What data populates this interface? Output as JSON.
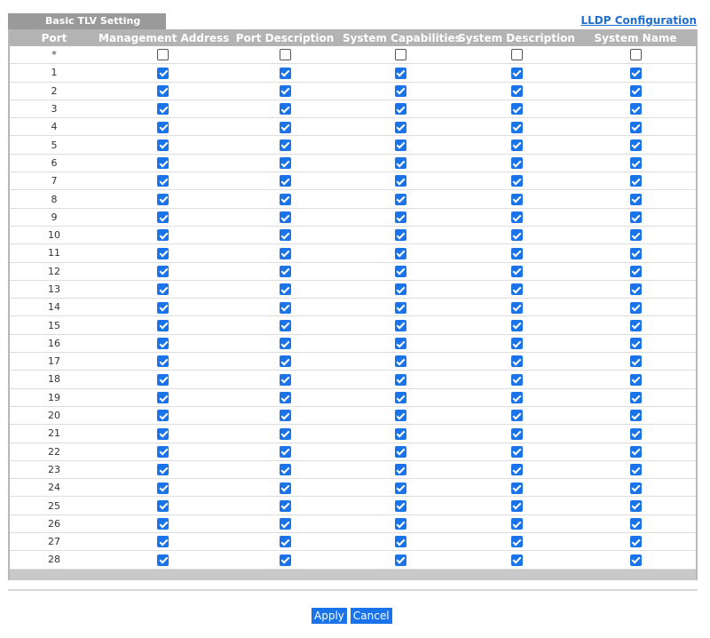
{
  "header": {
    "tab_title": "Basic TLV Setting",
    "config_link": "LLDP Configuration"
  },
  "table": {
    "columns": [
      "Port",
      "Management Address",
      "Port Description",
      "System Capabilities",
      "System Description",
      "System Name"
    ],
    "rows": [
      {
        "port": "*",
        "checked": [
          false,
          false,
          false,
          false,
          false
        ]
      },
      {
        "port": "1",
        "checked": [
          true,
          true,
          true,
          true,
          true
        ]
      },
      {
        "port": "2",
        "checked": [
          true,
          true,
          true,
          true,
          true
        ]
      },
      {
        "port": "3",
        "checked": [
          true,
          true,
          true,
          true,
          true
        ]
      },
      {
        "port": "4",
        "checked": [
          true,
          true,
          true,
          true,
          true
        ]
      },
      {
        "port": "5",
        "checked": [
          true,
          true,
          true,
          true,
          true
        ]
      },
      {
        "port": "6",
        "checked": [
          true,
          true,
          true,
          true,
          true
        ]
      },
      {
        "port": "7",
        "checked": [
          true,
          true,
          true,
          true,
          true
        ]
      },
      {
        "port": "8",
        "checked": [
          true,
          true,
          true,
          true,
          true
        ]
      },
      {
        "port": "9",
        "checked": [
          true,
          true,
          true,
          true,
          true
        ]
      },
      {
        "port": "10",
        "checked": [
          true,
          true,
          true,
          true,
          true
        ]
      },
      {
        "port": "11",
        "checked": [
          true,
          true,
          true,
          true,
          true
        ]
      },
      {
        "port": "12",
        "checked": [
          true,
          true,
          true,
          true,
          true
        ]
      },
      {
        "port": "13",
        "checked": [
          true,
          true,
          true,
          true,
          true
        ]
      },
      {
        "port": "14",
        "checked": [
          true,
          true,
          true,
          true,
          true
        ]
      },
      {
        "port": "15",
        "checked": [
          true,
          true,
          true,
          true,
          true
        ]
      },
      {
        "port": "16",
        "checked": [
          true,
          true,
          true,
          true,
          true
        ]
      },
      {
        "port": "17",
        "checked": [
          true,
          true,
          true,
          true,
          true
        ]
      },
      {
        "port": "18",
        "checked": [
          true,
          true,
          true,
          true,
          true
        ]
      },
      {
        "port": "19",
        "checked": [
          true,
          true,
          true,
          true,
          true
        ]
      },
      {
        "port": "20",
        "checked": [
          true,
          true,
          true,
          true,
          true
        ]
      },
      {
        "port": "21",
        "checked": [
          true,
          true,
          true,
          true,
          true
        ]
      },
      {
        "port": "22",
        "checked": [
          true,
          true,
          true,
          true,
          true
        ]
      },
      {
        "port": "23",
        "checked": [
          true,
          true,
          true,
          true,
          true
        ]
      },
      {
        "port": "24",
        "checked": [
          true,
          true,
          true,
          true,
          true
        ]
      },
      {
        "port": "25",
        "checked": [
          true,
          true,
          true,
          true,
          true
        ]
      },
      {
        "port": "26",
        "checked": [
          true,
          true,
          true,
          true,
          true
        ]
      },
      {
        "port": "27",
        "checked": [
          true,
          true,
          true,
          true,
          true
        ]
      },
      {
        "port": "28",
        "checked": [
          true,
          true,
          true,
          true,
          true
        ]
      }
    ]
  },
  "actions": {
    "apply_label": "Apply",
    "cancel_label": "Cancel"
  },
  "colors": {
    "accent": "#1a73e8",
    "link": "#1f6fd0",
    "header_bg": "#b3b3b3",
    "tab_bg": "#9a9a9a"
  },
  "icons": {
    "checked": "checkbox-checked-icon",
    "unchecked": "checkbox-unchecked-icon"
  }
}
